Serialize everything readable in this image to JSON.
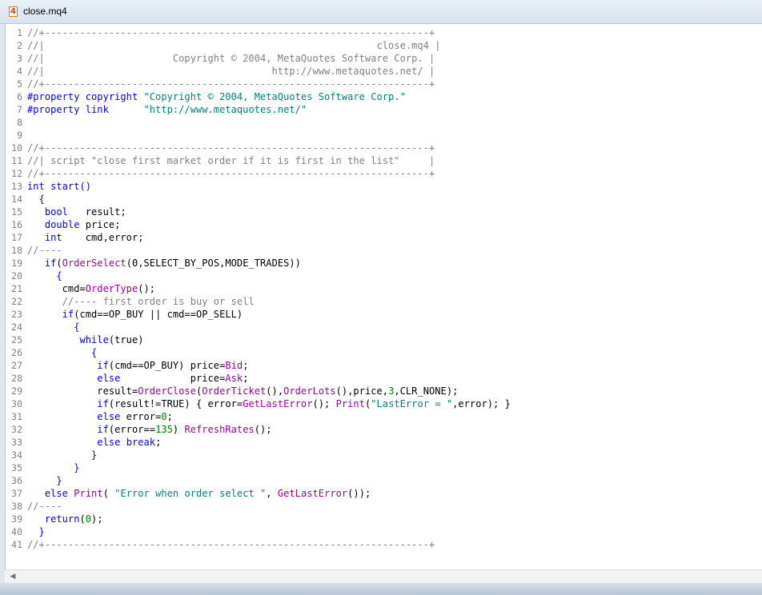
{
  "tab": {
    "file_icon_glyph": "4",
    "title": "close.mq4"
  },
  "code_lines": [
    {
      "n": "1",
      "segs": [
        {
          "t": "//+------------------------------------------------------------------+",
          "c": "cm"
        }
      ]
    },
    {
      "n": "2",
      "segs": [
        {
          "t": "//|                                                         close.mq4 |",
          "c": "cm"
        }
      ]
    },
    {
      "n": "3",
      "segs": [
        {
          "t": "//|                      Copyright © 2004, MetaQuotes Software Corp. |",
          "c": "cm"
        }
      ]
    },
    {
      "n": "4",
      "segs": [
        {
          "t": "//|                                       http://www.metaquotes.net/ |",
          "c": "cm"
        }
      ]
    },
    {
      "n": "5",
      "segs": [
        {
          "t": "//+------------------------------------------------------------------+",
          "c": "cm"
        }
      ]
    },
    {
      "n": "6",
      "segs": [
        {
          "t": "#property copyright ",
          "c": "pf"
        },
        {
          "t": "\"Copyright © 2004, MetaQuotes Software Corp.\"",
          "c": "st"
        }
      ]
    },
    {
      "n": "7",
      "segs": [
        {
          "t": "#property link      ",
          "c": "pf"
        },
        {
          "t": "\"http://www.metaquotes.net/\"",
          "c": "st"
        }
      ]
    },
    {
      "n": "8",
      "segs": []
    },
    {
      "n": "9",
      "segs": []
    },
    {
      "n": "10",
      "segs": [
        {
          "t": "//+------------------------------------------------------------------+",
          "c": "cm"
        }
      ]
    },
    {
      "n": "11",
      "segs": [
        {
          "t": "//| script \"close first market order if it is first in the list\"     |",
          "c": "cm"
        }
      ]
    },
    {
      "n": "12",
      "segs": [
        {
          "t": "//+------------------------------------------------------------------+",
          "c": "cm"
        }
      ]
    },
    {
      "n": "13",
      "segs": [
        {
          "t": "int",
          "c": "kw"
        },
        {
          "t": " ",
          "c": ""
        },
        {
          "t": "start",
          "c": "kw"
        },
        {
          "t": "()",
          "c": "kw"
        }
      ]
    },
    {
      "n": "14",
      "segs": [
        {
          "t": "  {",
          "c": "kw"
        }
      ]
    },
    {
      "n": "15",
      "segs": [
        {
          "t": "   ",
          "c": ""
        },
        {
          "t": "bool",
          "c": "kw"
        },
        {
          "t": "   result;",
          "c": ""
        }
      ]
    },
    {
      "n": "16",
      "segs": [
        {
          "t": "   ",
          "c": ""
        },
        {
          "t": "double",
          "c": "kw"
        },
        {
          "t": " price;",
          "c": ""
        }
      ]
    },
    {
      "n": "17",
      "segs": [
        {
          "t": "   ",
          "c": ""
        },
        {
          "t": "int",
          "c": "kw"
        },
        {
          "t": "    cmd,error;",
          "c": ""
        }
      ]
    },
    {
      "n": "18",
      "segs": [
        {
          "t": "//----",
          "c": "cm"
        }
      ]
    },
    {
      "n": "19",
      "segs": [
        {
          "t": "   ",
          "c": ""
        },
        {
          "t": "if",
          "c": "kw"
        },
        {
          "t": "(",
          "c": ""
        },
        {
          "t": "OrderSelect",
          "c": "fn"
        },
        {
          "t": "(0,SELECT_BY_POS,MODE_TRADES))",
          "c": ""
        }
      ]
    },
    {
      "n": "20",
      "segs": [
        {
          "t": "     {",
          "c": "kw"
        }
      ]
    },
    {
      "n": "21",
      "segs": [
        {
          "t": "      cmd=",
          "c": ""
        },
        {
          "t": "OrderType",
          "c": "fn"
        },
        {
          "t": "();",
          "c": ""
        }
      ]
    },
    {
      "n": "22",
      "segs": [
        {
          "t": "      //---- first order is buy or sell",
          "c": "cm"
        }
      ]
    },
    {
      "n": "23",
      "segs": [
        {
          "t": "      ",
          "c": ""
        },
        {
          "t": "if",
          "c": "kw"
        },
        {
          "t": "(cmd==OP_BUY || cmd==OP_SELL)",
          "c": ""
        }
      ]
    },
    {
      "n": "24",
      "segs": [
        {
          "t": "        {",
          "c": "kw"
        }
      ]
    },
    {
      "n": "25",
      "segs": [
        {
          "t": "         ",
          "c": ""
        },
        {
          "t": "while",
          "c": "kw"
        },
        {
          "t": "(true)",
          "c": ""
        }
      ]
    },
    {
      "n": "26",
      "segs": [
        {
          "t": "           {",
          "c": "kw"
        }
      ]
    },
    {
      "n": "27",
      "segs": [
        {
          "t": "            ",
          "c": ""
        },
        {
          "t": "if",
          "c": "kw"
        },
        {
          "t": "(cmd==OP_BUY) price=",
          "c": ""
        },
        {
          "t": "Bid",
          "c": "fn"
        },
        {
          "t": ";",
          "c": ""
        }
      ]
    },
    {
      "n": "28",
      "segs": [
        {
          "t": "            ",
          "c": ""
        },
        {
          "t": "else",
          "c": "kw"
        },
        {
          "t": "            price=",
          "c": ""
        },
        {
          "t": "Ask",
          "c": "fn"
        },
        {
          "t": ";",
          "c": ""
        }
      ]
    },
    {
      "n": "29",
      "segs": [
        {
          "t": "            result=",
          "c": ""
        },
        {
          "t": "OrderClose",
          "c": "fn"
        },
        {
          "t": "(",
          "c": ""
        },
        {
          "t": "OrderTicket",
          "c": "fn"
        },
        {
          "t": "(),",
          "c": ""
        },
        {
          "t": "OrderLots",
          "c": "fn"
        },
        {
          "t": "(),price,",
          "c": ""
        },
        {
          "t": "3",
          "c": "nm"
        },
        {
          "t": ",CLR_NONE);",
          "c": ""
        }
      ]
    },
    {
      "n": "30",
      "segs": [
        {
          "t": "            ",
          "c": ""
        },
        {
          "t": "if",
          "c": "kw"
        },
        {
          "t": "(result!=TRUE) { error=",
          "c": ""
        },
        {
          "t": "GetLastError",
          "c": "fn"
        },
        {
          "t": "(); ",
          "c": ""
        },
        {
          "t": "Print",
          "c": "fn"
        },
        {
          "t": "(",
          "c": ""
        },
        {
          "t": "\"LastError = \"",
          "c": "st"
        },
        {
          "t": ",error); }",
          "c": ""
        }
      ]
    },
    {
      "n": "31",
      "segs": [
        {
          "t": "            ",
          "c": ""
        },
        {
          "t": "else",
          "c": "kw"
        },
        {
          "t": " error=",
          "c": ""
        },
        {
          "t": "0",
          "c": "nm"
        },
        {
          "t": ";",
          "c": ""
        }
      ]
    },
    {
      "n": "32",
      "segs": [
        {
          "t": "            ",
          "c": ""
        },
        {
          "t": "if",
          "c": "kw"
        },
        {
          "t": "(error==",
          "c": ""
        },
        {
          "t": "135",
          "c": "nm"
        },
        {
          "t": ") ",
          "c": ""
        },
        {
          "t": "RefreshRates",
          "c": "fn"
        },
        {
          "t": "();",
          "c": ""
        }
      ]
    },
    {
      "n": "33",
      "segs": [
        {
          "t": "            ",
          "c": ""
        },
        {
          "t": "else",
          "c": "kw"
        },
        {
          "t": " ",
          "c": ""
        },
        {
          "t": "break",
          "c": "kw"
        },
        {
          "t": ";",
          "c": ""
        }
      ]
    },
    {
      "n": "34",
      "segs": [
        {
          "t": "           }",
          "c": "kw"
        }
      ]
    },
    {
      "n": "35",
      "segs": [
        {
          "t": "        }",
          "c": "kw"
        }
      ]
    },
    {
      "n": "36",
      "segs": [
        {
          "t": "     }",
          "c": "kw"
        }
      ]
    },
    {
      "n": "37",
      "segs": [
        {
          "t": "   ",
          "c": ""
        },
        {
          "t": "else",
          "c": "kw"
        },
        {
          "t": " ",
          "c": ""
        },
        {
          "t": "Print",
          "c": "fn"
        },
        {
          "t": "( ",
          "c": ""
        },
        {
          "t": "\"Error when order select \"",
          "c": "st"
        },
        {
          "t": ", ",
          "c": ""
        },
        {
          "t": "GetLastError",
          "c": "fn"
        },
        {
          "t": "());",
          "c": ""
        }
      ]
    },
    {
      "n": "38",
      "segs": [
        {
          "t": "//----",
          "c": "cm"
        }
      ]
    },
    {
      "n": "39",
      "segs": [
        {
          "t": "   ",
          "c": ""
        },
        {
          "t": "return",
          "c": "kw"
        },
        {
          "t": "(",
          "c": ""
        },
        {
          "t": "0",
          "c": "nm"
        },
        {
          "t": ");",
          "c": ""
        }
      ]
    },
    {
      "n": "40",
      "segs": [
        {
          "t": "  }",
          "c": "kw"
        }
      ]
    },
    {
      "n": "41",
      "segs": [
        {
          "t": "//+------------------------------------------------------------------+",
          "c": "cm"
        }
      ]
    }
  ],
  "scrollbar": {
    "left_arrow_glyph": "◀"
  },
  "colors": {
    "comment": "#808080",
    "keyword": "#0000ff",
    "string": "#008080",
    "number": "#008000",
    "function": "#a000a0"
  }
}
